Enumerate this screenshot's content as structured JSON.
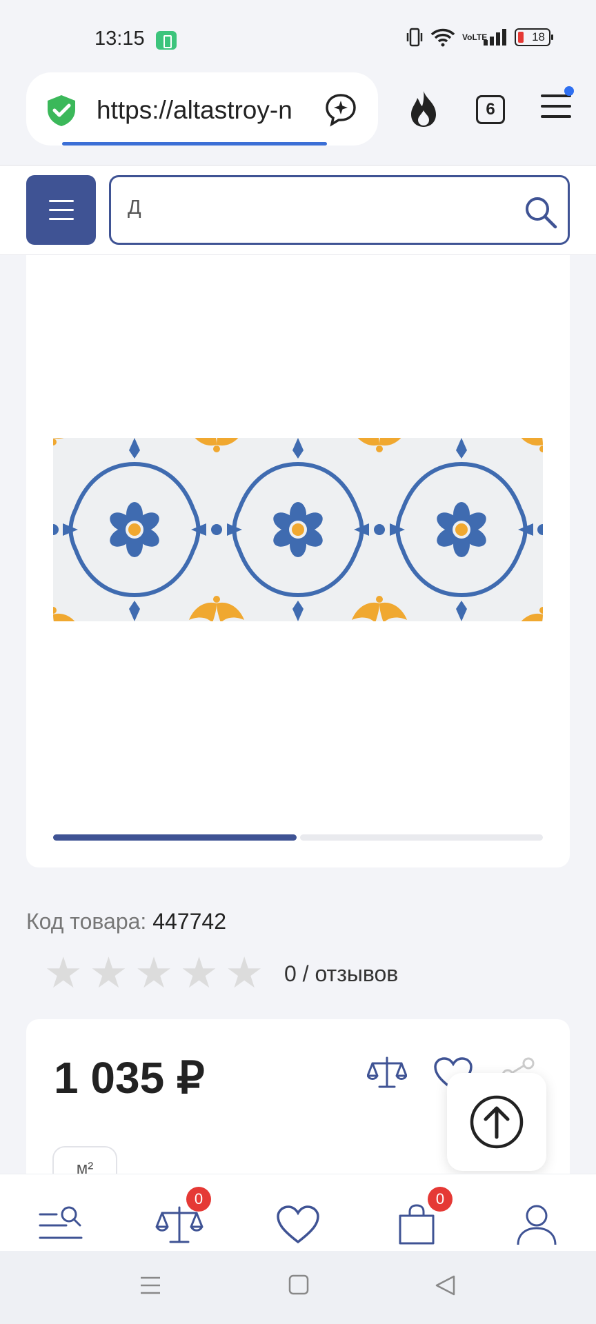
{
  "status": {
    "time": "13:15",
    "network": "VoLTE",
    "battery": "18",
    "icons": [
      "battery-saver-icon",
      "vibrate-icon",
      "wifi-icon",
      "volte-icon",
      "signal-icon",
      "battery-icon"
    ]
  },
  "browser": {
    "url": "https://altastroy-n",
    "tab_count": "6",
    "load_progress": 0.75,
    "accent": "#3b6fd6"
  },
  "site": {
    "search": {
      "value": "Д"
    },
    "brand_color": "#3f5394"
  },
  "gallery": {
    "image": "blue-orange-floral-tile",
    "slide_index": 1,
    "slide_total": 2
  },
  "product": {
    "code_label": "Код товара:",
    "code_value": "447742",
    "rating": 0,
    "rating_max": 5,
    "reviews_text": "0 / отзывов",
    "price": "1 035 ₽",
    "unit": "м²"
  },
  "bottom_nav": {
    "items": [
      {
        "name": "catalog-search",
        "icon": "search-list-icon"
      },
      {
        "name": "compare",
        "icon": "scales-icon",
        "badge": "0"
      },
      {
        "name": "favorites",
        "icon": "heart-icon"
      },
      {
        "name": "cart",
        "icon": "bag-icon",
        "badge": "0"
      },
      {
        "name": "profile",
        "icon": "user-icon"
      }
    ],
    "badge_color": "#e53935"
  }
}
